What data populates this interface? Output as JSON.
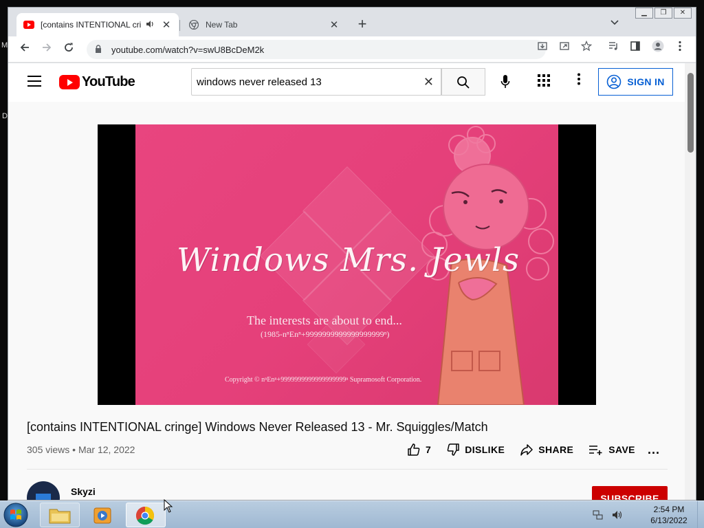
{
  "desktop": {
    "letters": [
      "M",
      "D"
    ]
  },
  "browser": {
    "tabs": [
      {
        "title": "[contains INTENTIONAL cringe] Windows Never Released 13 - Mr. Squiggles/Match",
        "active": true
      },
      {
        "title": "New Tab",
        "active": false
      }
    ],
    "url": "youtube.com/watch?v=swU8BcDeM2k"
  },
  "youtube": {
    "logo_text": "YouTube",
    "search_value": "windows never released 13",
    "sign_in_label": "SIGN IN",
    "player": {
      "frame_title": "Windows Mrs. Jewls",
      "frame_subtitle": "The interests are about to end...",
      "frame_subtitle2": "(1985-nⁿEnⁿ+9999999999999999999ⁿ)",
      "frame_copyright": "Copyright © nⁿEnⁿ+9999999999999999999ⁿ Supramosoft Corporation."
    },
    "video_title": "[contains INTENTIONAL cringe] Windows Never Released 13 - Mr. Squiggles/Match",
    "views": "305 views",
    "date": "Mar 12, 2022",
    "meta_separator": " • ",
    "like_count": "7",
    "dislike_label": "DISLIKE",
    "share_label": "SHARE",
    "save_label": "SAVE",
    "more_label": "...",
    "channel_name": "Skyzi",
    "subscribe_label": "SUBSCRIBE"
  },
  "taskbar": {
    "time": "2:54 PM",
    "date": "6/13/2022"
  }
}
